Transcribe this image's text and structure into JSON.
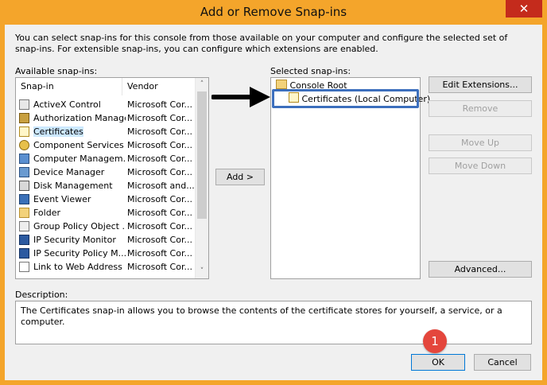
{
  "window": {
    "title": "Add or Remove Snap-ins",
    "close_glyph": "✕"
  },
  "intro_text": "You can select snap-ins for this console from those available on your computer and configure the selected set of snap-ins. For extensible snap-ins, you can configure which extensions are enabled.",
  "available": {
    "label": "Available snap-ins:",
    "col_snapin": "Snap-in",
    "col_vendor": "Vendor",
    "rows": [
      {
        "name": "ActiveX Control",
        "vendor": "Microsoft Cor..."
      },
      {
        "name": "Authorization Manager",
        "vendor": "Microsoft Cor..."
      },
      {
        "name": "Certificates",
        "vendor": "Microsoft Cor..."
      },
      {
        "name": "Component Services",
        "vendor": "Microsoft Cor..."
      },
      {
        "name": "Computer Managem...",
        "vendor": "Microsoft Cor..."
      },
      {
        "name": "Device Manager",
        "vendor": "Microsoft Cor..."
      },
      {
        "name": "Disk Management",
        "vendor": "Microsoft and..."
      },
      {
        "name": "Event Viewer",
        "vendor": "Microsoft Cor..."
      },
      {
        "name": "Folder",
        "vendor": "Microsoft Cor..."
      },
      {
        "name": "Group Policy Object ...",
        "vendor": "Microsoft Cor..."
      },
      {
        "name": "IP Security Monitor",
        "vendor": "Microsoft Cor..."
      },
      {
        "name": "IP Security Policy M...",
        "vendor": "Microsoft Cor..."
      },
      {
        "name": "Link to Web Address",
        "vendor": "Microsoft Cor..."
      }
    ],
    "scroll_up": "˄",
    "scroll_down": "˅"
  },
  "add_button": "Add >",
  "selected": {
    "label": "Selected snap-ins:",
    "root": "Console Root",
    "child": "Certificates (Local Computer)"
  },
  "buttons": {
    "edit_extensions": "Edit Extensions...",
    "remove": "Remove",
    "move_up": "Move Up",
    "move_down": "Move Down",
    "advanced": "Advanced...",
    "ok": "OK",
    "cancel": "Cancel"
  },
  "description": {
    "label": "Description:",
    "text": "The Certificates snap-in allows you to browse the contents of the certificate stores for yourself, a service, or a computer."
  },
  "annotation_badge": "1",
  "colors": {
    "titlebar": "#f4a52b",
    "close": "#c42b1c",
    "selection": "#cce8ff",
    "highlight_border": "#3c6fbd",
    "badge": "#e4463c"
  }
}
